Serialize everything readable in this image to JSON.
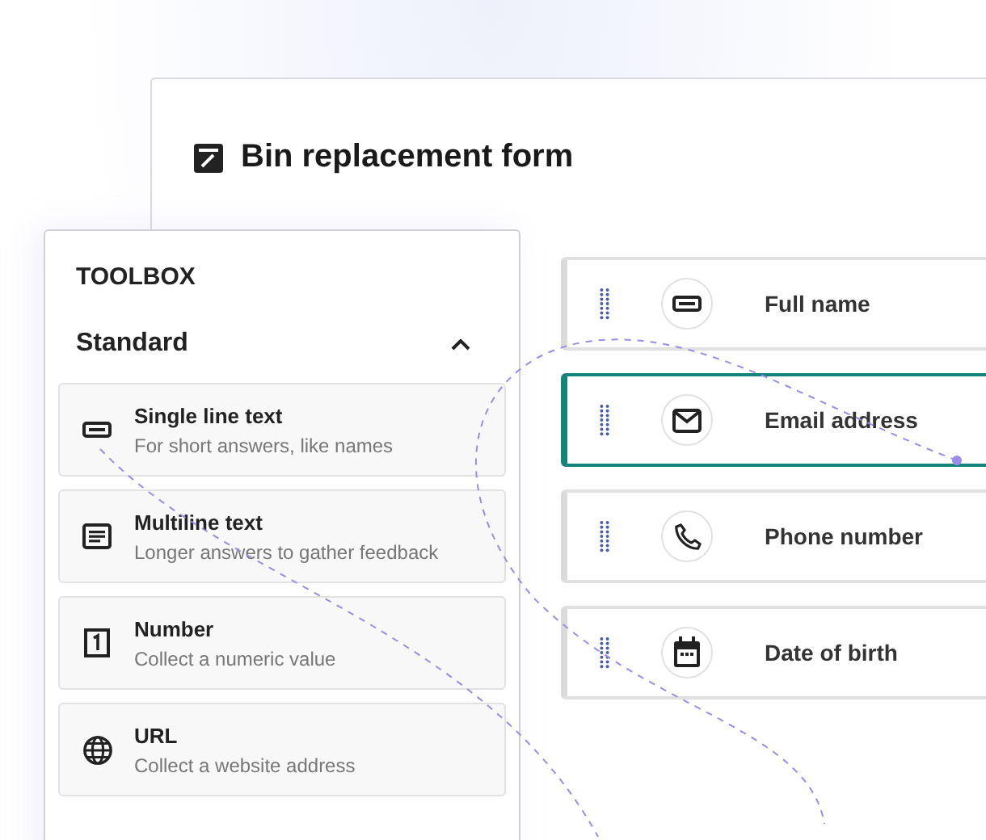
{
  "form": {
    "title": "Bin replacement form",
    "fields": [
      {
        "label": "Full name",
        "kind": "text",
        "selected": false
      },
      {
        "label": "Email address",
        "kind": "email",
        "selected": true
      },
      {
        "label": "Phone number",
        "kind": "phone",
        "selected": false
      },
      {
        "label": "Date of birth",
        "kind": "date",
        "selected": false
      }
    ]
  },
  "toolbox": {
    "title": "TOOLBOX",
    "section": {
      "title": "Standard",
      "expanded": true
    },
    "items": [
      {
        "kind": "single",
        "title": "Single line text",
        "description": "For short answers, like names"
      },
      {
        "kind": "multi",
        "title": "Multiline text",
        "description": "Longer answers to gather feedback"
      },
      {
        "kind": "number",
        "title": "Number",
        "description": "Collect a numeric value"
      },
      {
        "kind": "url",
        "title": "URL",
        "description": "Collect a website address"
      }
    ]
  }
}
